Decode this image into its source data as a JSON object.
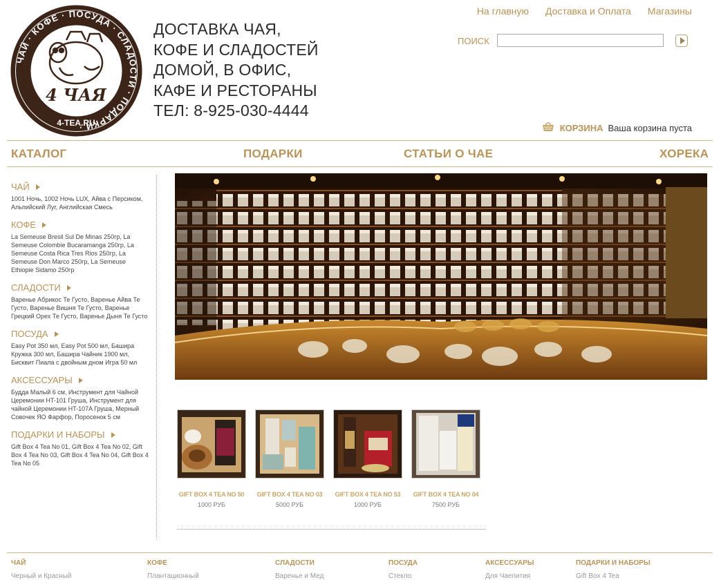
{
  "logo": {
    "ring_text": "ЧАЙ · КОФЕ · ПОСУДА · СЛАДОСТИ · ПОДАРКИ ·",
    "center_text": "4 ЧАЯ",
    "bottom_text": "4-TEA.RU"
  },
  "tagline": [
    "ДОСТАВКА ЧАЯ,",
    "КОФЕ И СЛАДОСТЕЙ",
    "ДОМОЙ, В ОФИС,",
    "КАФЕ И РЕСТОРАНЫ",
    "ТЕЛ: 8-925-030-4444"
  ],
  "topnav": {
    "home": "На главную",
    "delivery": "Доставка и Оплата",
    "stores": "Магазины"
  },
  "search": {
    "label": "ПОИСК",
    "value": "",
    "placeholder": ""
  },
  "cart": {
    "label": "КОРЗИНА",
    "status": "Ваша корзина пуста"
  },
  "mainnav": {
    "catalog": "КАТАЛОГ",
    "gifts": "ПОДАРКИ",
    "articles": "СТАТЬИ О ЧАЕ",
    "horeca": "ХОРЕКА"
  },
  "sidebar": [
    {
      "title": "ЧАЙ",
      "items": "1001 Ночь, 1002 Ночь LUX, Айва с Персиком, Альпийский Луг, Английская Смесь"
    },
    {
      "title": "КОФЕ",
      "items": "La Semeuse Bresil Sul De Minas 250гр, La Semeuse Colombie Bucaramanga 250гр, La Semeuse Costa Rica Tres Rios 250гр, La Semeuse Don Marco 250гр, La Semeuse Ethiopie Sidamo 250гр"
    },
    {
      "title": "СЛАДОСТИ",
      "items": "Варенье Абрикос Те Густо, Варенье Айва Те Густо, Варенье Вишня Те Густо, Варенье Грецкий Орех Те Густо, Варенье Дыня Те Густо"
    },
    {
      "title": "ПОСУДА",
      "items": "Easy Pot 350 мл, Easy Pot 500 мл, Башира Кружка 300 мл, Башира Чайник 1900 мл, Бисквит Пиала с двойным дном Игра 50 мл"
    },
    {
      "title": "АКСЕССУАРЫ",
      "items": "Будда Малый 6 см, Инструмент для Чайной Церемонии HT-101 Груша, Инструмент для чайной Церемонии HT-107A Груша, Мерный Совочек ЯО Фарфор, Поросенок 5 см"
    },
    {
      "title": "ПОДАРКИ И НАБОРЫ",
      "items": "Gift Box 4 Tea No 01, Gift Box 4 Tea No 02, Gift Box 4 Tea No 03, Gift Box 4 Tea No 04, Gift Box 4 Tea No 05"
    }
  ],
  "products": [
    {
      "name": "GIFT BOX 4 TEA NO 50",
      "price": "1000 РУБ"
    },
    {
      "name": "GIFT BOX 4 TEA NO 03",
      "price": "5000 РУБ"
    },
    {
      "name": "GIFT BOX 4 TEA NO 53",
      "price": "1000 РУБ"
    },
    {
      "name": "GIFT BOX 4 TEA NO 04",
      "price": "7500 РУБ"
    }
  ],
  "footer": [
    {
      "title": "ЧАЙ",
      "link": "Черный и Красный"
    },
    {
      "title": "КОФЕ",
      "link": "Плантационный"
    },
    {
      "title": "СЛАДОСТИ",
      "link": "Варенье и Мед"
    },
    {
      "title": "ПОСУДА",
      "link": "Стекло"
    },
    {
      "title": "АКСЕССУАРЫ",
      "link": "Для Чаепития"
    },
    {
      "title": "ПОДАРКИ И НАБОРЫ",
      "link": "Gift Box 4 Tea"
    }
  ],
  "colors": {
    "accent": "#b8945a",
    "logo_brown": "#3d2418",
    "divider": "#cdb98c"
  }
}
